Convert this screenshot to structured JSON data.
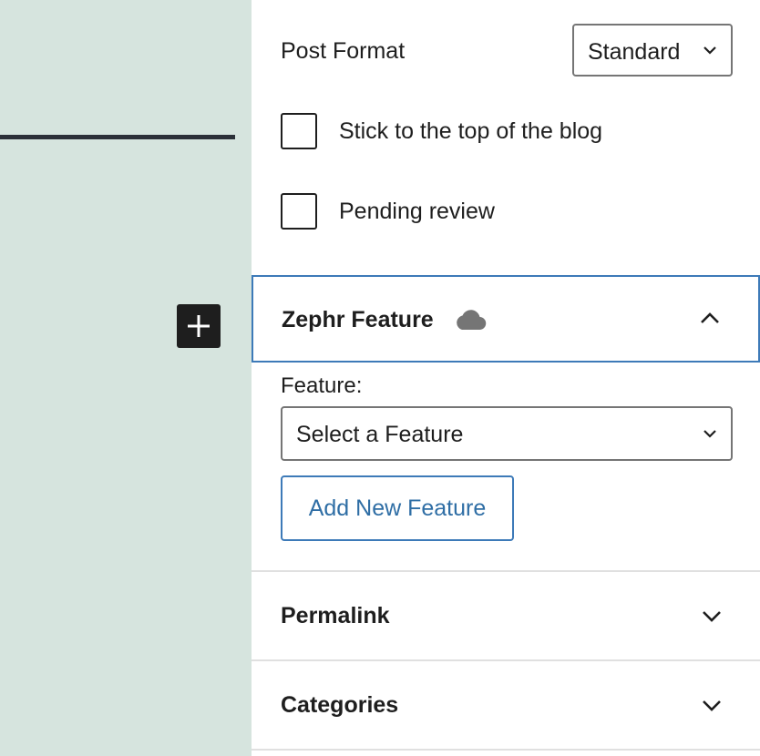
{
  "post_format": {
    "label": "Post Format",
    "selected": "Standard"
  },
  "checkboxes": [
    {
      "label": "Stick to the top of the blog",
      "checked": false
    },
    {
      "label": "Pending review",
      "checked": false
    }
  ],
  "zephr_panel": {
    "title": "Zephr Feature",
    "icon": "cloud-icon",
    "expanded": true,
    "feature_label": "Feature:",
    "feature_select": "Select a Feature",
    "add_button": "Add New Feature"
  },
  "panels": [
    {
      "title": "Permalink",
      "expanded": false
    },
    {
      "title": "Categories",
      "expanded": false
    }
  ],
  "colors": {
    "canvas_bg": "#d6e4de",
    "accent": "#3d7ab8",
    "link": "#2f6ea5",
    "text": "#1e1e1e"
  }
}
